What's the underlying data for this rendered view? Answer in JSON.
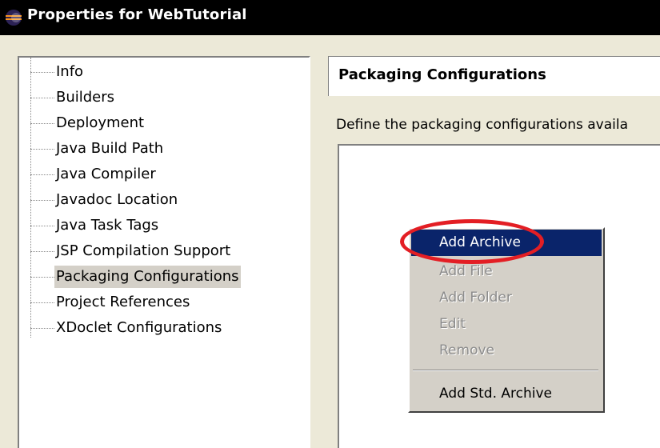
{
  "window": {
    "title": "Properties for WebTutorial",
    "icon": "eclipse-icon",
    "titlebar_color": "#000000"
  },
  "tree": {
    "items": [
      {
        "label": "Info"
      },
      {
        "label": "Builders"
      },
      {
        "label": "Deployment"
      },
      {
        "label": "Java Build Path"
      },
      {
        "label": "Java Compiler"
      },
      {
        "label": "Javadoc Location"
      },
      {
        "label": "Java Task Tags"
      },
      {
        "label": "JSP Compilation Support"
      },
      {
        "label": "Packaging Configurations",
        "selected": true
      },
      {
        "label": "Project References"
      },
      {
        "label": "XDoclet Configurations"
      }
    ]
  },
  "page": {
    "title": "Packaging Configurations",
    "description": "Define the packaging configurations availa"
  },
  "context_menu": {
    "items": [
      {
        "label": "Add Archive",
        "state": "highlighted"
      },
      {
        "label": "Add File",
        "state": "disabled"
      },
      {
        "label": "Add Folder",
        "state": "disabled"
      },
      {
        "label": "Edit",
        "state": "disabled"
      },
      {
        "label": "Remove",
        "state": "disabled"
      },
      {
        "label": "Add Std. Archive",
        "state": "enabled"
      }
    ],
    "highlight_color": "#0a246a"
  },
  "annotation": {
    "shape": "ellipse",
    "color": "#e31e24",
    "target": "Add Archive"
  }
}
